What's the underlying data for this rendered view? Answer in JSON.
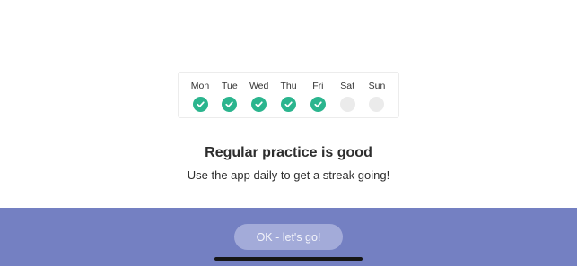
{
  "week": {
    "days": [
      {
        "label": "Mon",
        "status": "done",
        "icon": "checkmark-icon"
      },
      {
        "label": "Tue",
        "status": "done",
        "icon": "checkmark-icon"
      },
      {
        "label": "Wed",
        "status": "done",
        "icon": "checkmark-icon"
      },
      {
        "label": "Thu",
        "status": "done",
        "icon": "checkmark-icon"
      },
      {
        "label": "Fri",
        "status": "done",
        "icon": "checkmark-icon"
      },
      {
        "label": "Sat",
        "status": "empty",
        "icon": "empty-circle-icon"
      },
      {
        "label": "Sun",
        "status": "empty",
        "icon": "empty-circle-icon"
      }
    ]
  },
  "content": {
    "headline": "Regular practice is good",
    "subline": "Use the app daily to get a streak going!"
  },
  "footer": {
    "ok_button_label": "OK - let's go!"
  },
  "colors": {
    "check_green": "#2bb58e",
    "empty_gray": "#ebebeb",
    "footer_background": "#7480c2",
    "button_background": "#a3abd9"
  }
}
